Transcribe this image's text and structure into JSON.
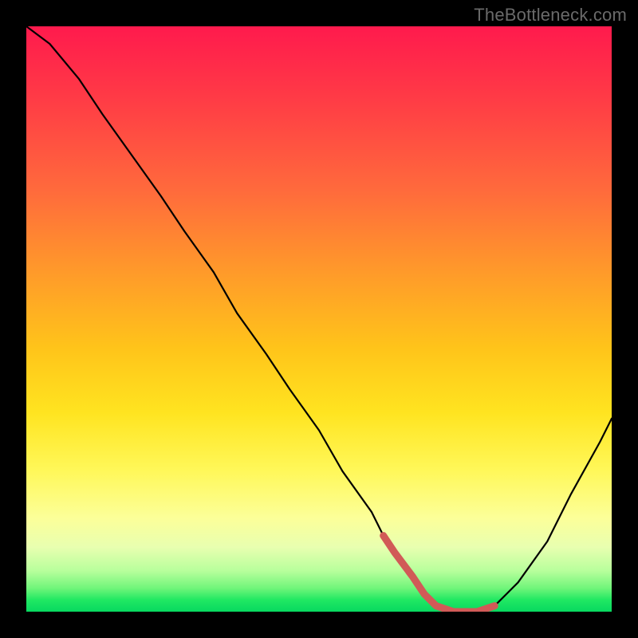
{
  "watermark": "TheBottleneck.com",
  "colors": {
    "background": "#000000",
    "gradient_top": "#ff1a4d",
    "gradient_bottom": "#08d860",
    "curve": "#000000",
    "highlight": "#d15a57"
  },
  "chart_data": {
    "type": "line",
    "title": "",
    "xlabel": "",
    "ylabel": "",
    "xlim": [
      0,
      100
    ],
    "ylim": [
      0,
      100
    ],
    "grid": false,
    "legend": false,
    "series": [
      {
        "name": "bottleneck-curve",
        "x": [
          0,
          4,
          9,
          13,
          18,
          23,
          27,
          32,
          36,
          41,
          45,
          50,
          54,
          59,
          61,
          63,
          66,
          68,
          70,
          73,
          75,
          77,
          80,
          84,
          89,
          93,
          98,
          100
        ],
        "values": [
          100,
          97,
          91,
          85,
          78,
          71,
          65,
          58,
          51,
          44,
          38,
          31,
          24,
          17,
          13,
          10,
          6,
          3,
          1,
          0,
          0,
          0,
          1,
          5,
          12,
          20,
          29,
          33
        ]
      }
    ],
    "annotations": [
      {
        "name": "optimal-range",
        "x_start": 61,
        "x_end": 80,
        "color": "#d15a57"
      }
    ]
  }
}
